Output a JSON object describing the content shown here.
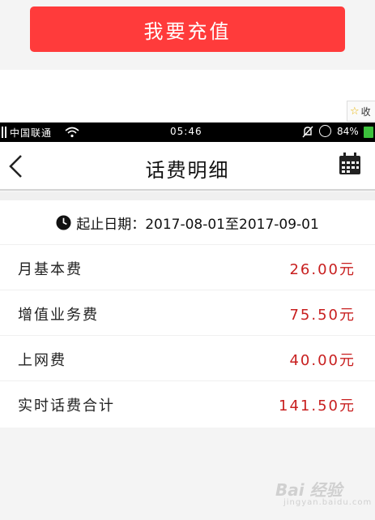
{
  "recharge": {
    "label": "我要充值"
  },
  "browser": {
    "favorite_label": "收"
  },
  "statusbar": {
    "carrier": "中国联通",
    "time": "05:46",
    "battery": "84%"
  },
  "header": {
    "title": "话费明细"
  },
  "period": {
    "text": "起止日期：2017-08-01至2017-09-01"
  },
  "fees": [
    {
      "label": "月基本费",
      "amount": "26.00元"
    },
    {
      "label": "增值业务费",
      "amount": "75.50元"
    },
    {
      "label": "上网费",
      "amount": "40.00元"
    },
    {
      "label": "实时话费合计",
      "amount": "141.50元"
    }
  ],
  "watermark": {
    "brand": "Bai 经验",
    "sub": "jingyan.baidu.com"
  },
  "colors": {
    "accent": "#ff3b3b",
    "amount": "#c81f1f"
  }
}
